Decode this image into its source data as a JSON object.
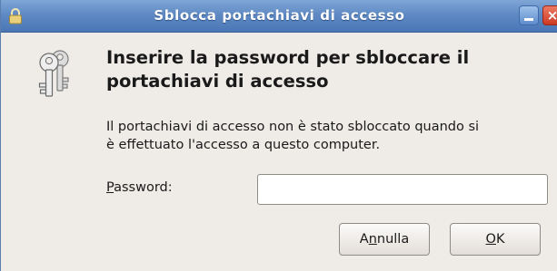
{
  "window": {
    "title": "Sblocca portachiavi di accesso",
    "close_glyph": "×"
  },
  "dialog": {
    "icon": "keys-icon",
    "heading_line1": "Inserire la password per sbloccare il",
    "heading_line2": "portachiavi di accesso",
    "description_line1": "Il portachiavi di accesso non è stato sbloccato quando si",
    "description_line2": "è effettuato l'accesso a questo computer.",
    "password_label_mnemonic": "P",
    "password_label_rest": "assword:",
    "password_value": ""
  },
  "buttons": {
    "cancel_pre": "A",
    "cancel_mnemonic": "n",
    "cancel_post": "nulla",
    "ok_mnemonic": "O",
    "ok_post": "K"
  },
  "colors": {
    "titlebar": "#5f8ac4",
    "window_bg": "#efebe7",
    "close_button": "#cd3a22"
  }
}
